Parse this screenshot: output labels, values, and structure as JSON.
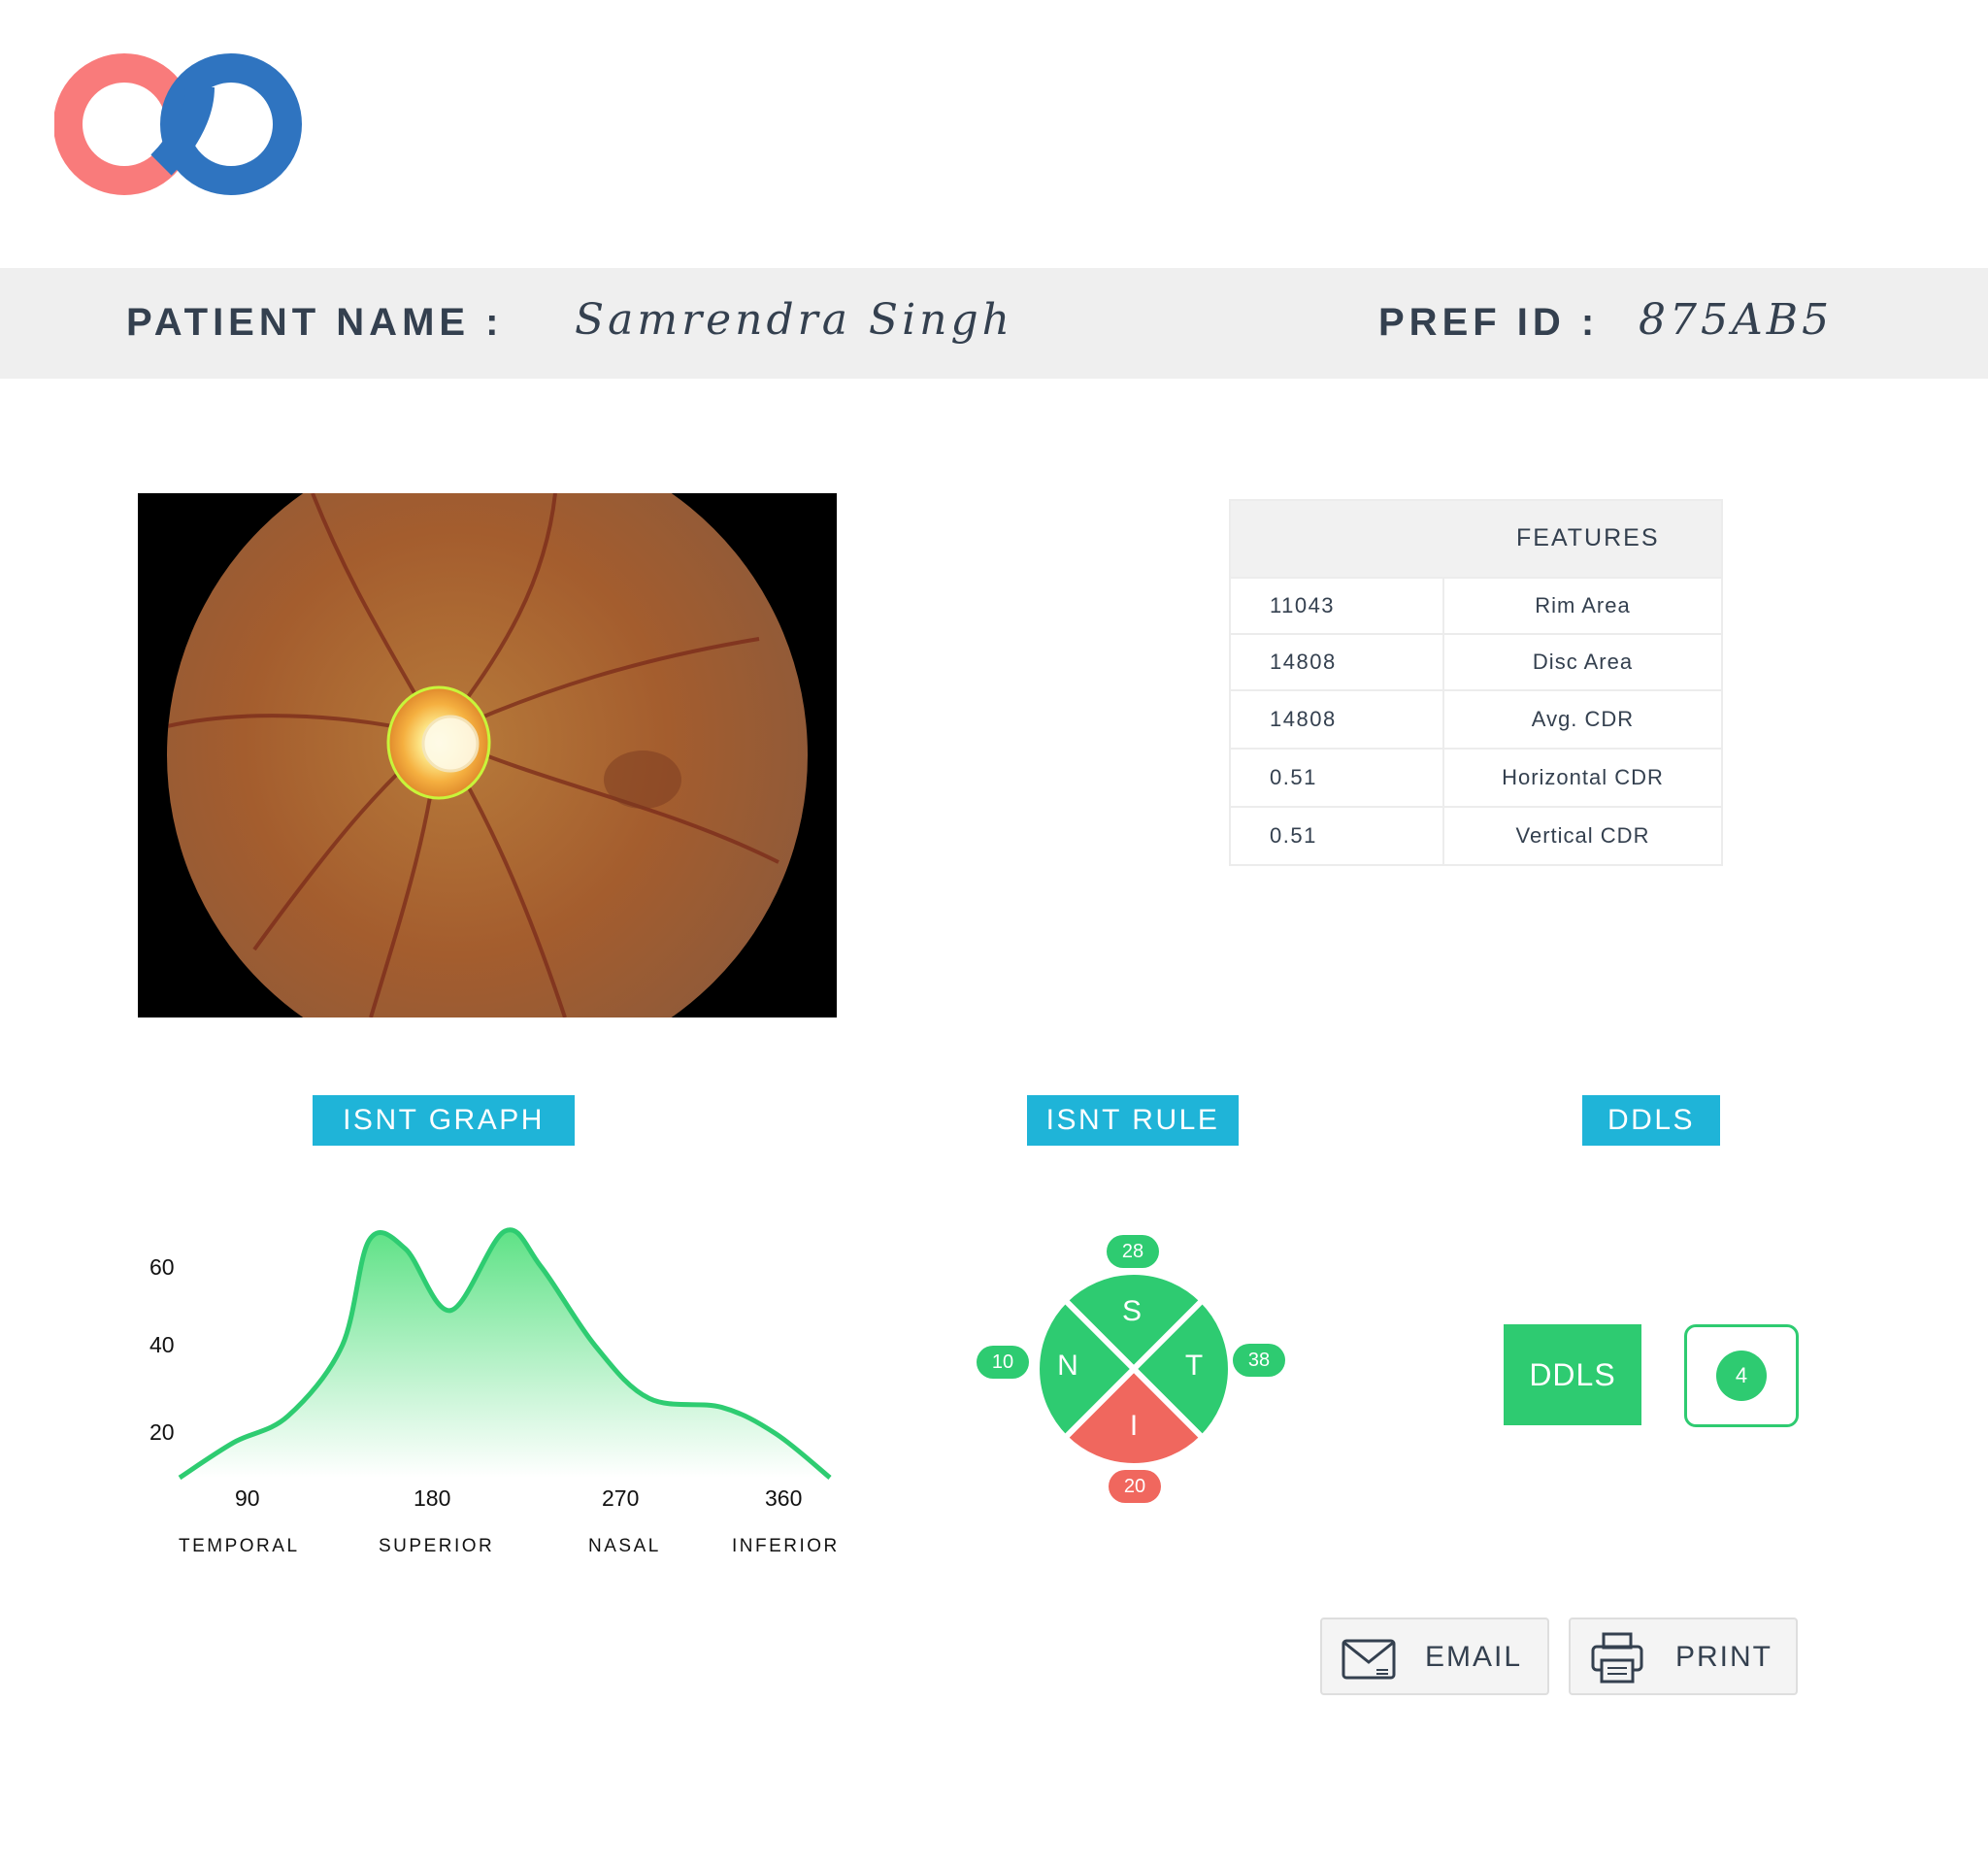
{
  "header": {
    "patient_name_label": "PATIENT NAME :",
    "patient_name": "Samrendra Singh",
    "pref_id_label": "PREF ID :",
    "pref_id": "875AB5"
  },
  "logo": {
    "icon": "infinity-logo-icon",
    "colors": [
      "#f97b7b",
      "#2f74c0"
    ]
  },
  "features": {
    "header": "FEATURES",
    "rows": [
      {
        "value": "11043",
        "name": "Rim Area"
      },
      {
        "value": "14808",
        "name": "Disc Area"
      },
      {
        "value": "14808",
        "name": "Avg. CDR"
      },
      {
        "value": "0.51",
        "name": "Horizontal CDR"
      },
      {
        "value": "0.51",
        "name": "Vertical CDR"
      }
    ]
  },
  "sections": {
    "isnt_graph": "ISNT GRAPH",
    "isnt_rule": "ISNT RULE",
    "ddls": "DDLS"
  },
  "chart_data": {
    "type": "area",
    "y_ticks": [
      "60",
      "40",
      "20"
    ],
    "x_ticks": [
      "90",
      "180",
      "270",
      "360"
    ],
    "regions": [
      "TEMPORAL",
      "SUPERIOR",
      "NASAL",
      "INFERIOR"
    ],
    "x": [
      0,
      30,
      60,
      90,
      105,
      125,
      150,
      180,
      200,
      230,
      260,
      300,
      330,
      360
    ],
    "y": [
      10,
      18,
      24,
      40,
      64,
      62,
      48,
      66,
      58,
      40,
      28,
      26,
      20,
      10
    ],
    "ylim": [
      10,
      70
    ],
    "xlim": [
      0,
      360
    ],
    "color": "#2ecc71"
  },
  "isnt_rule": {
    "quadrants": [
      {
        "letter": "S",
        "value": "28",
        "status": "good"
      },
      {
        "letter": "N",
        "value": "10",
        "status": "good"
      },
      {
        "letter": "T",
        "value": "38",
        "status": "good"
      },
      {
        "letter": "I",
        "value": "20",
        "status": "bad"
      }
    ],
    "colors": {
      "good": "#2ecb71",
      "bad": "#f0675e"
    }
  },
  "ddls": {
    "label": "DDLS",
    "score": "4"
  },
  "actions": {
    "email_label": "EMAIL",
    "email_icon": "envelope-icon",
    "print_label": "PRINT",
    "print_icon": "printer-icon"
  }
}
